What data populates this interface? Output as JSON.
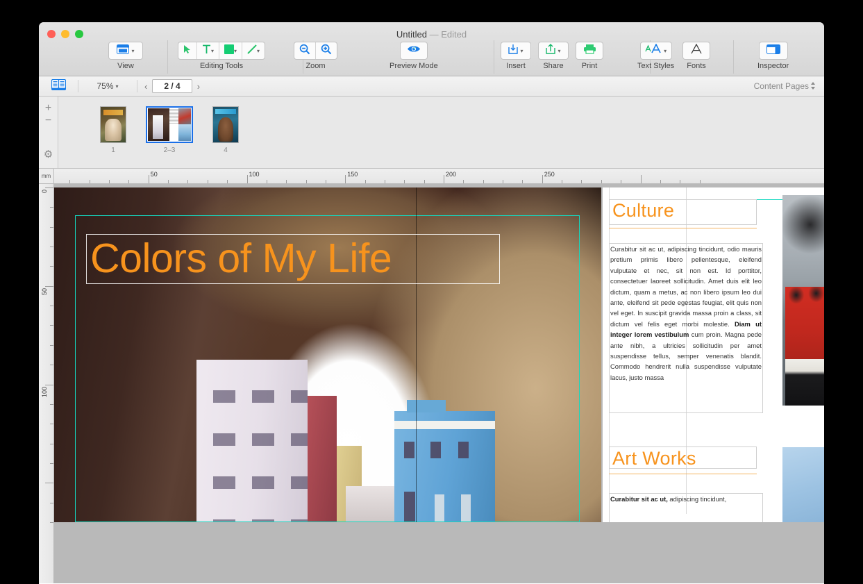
{
  "window": {
    "title": "Untitled",
    "title_state": "— Edited",
    "traffic_lights": [
      "close",
      "minimize",
      "zoom"
    ]
  },
  "toolbar": {
    "groups": [
      {
        "name": "view",
        "label": "View",
        "icon": "window-layout-icon"
      },
      {
        "name": "editing-tools",
        "label": "Editing Tools",
        "items": [
          {
            "name": "select-tool",
            "icon": "arrow-cursor-icon"
          },
          {
            "name": "text-tool",
            "icon": "text-T-icon"
          },
          {
            "name": "shape-tool",
            "icon": "filled-square-icon"
          },
          {
            "name": "line-tool",
            "icon": "diagonal-line-icon"
          }
        ]
      },
      {
        "name": "zoom",
        "label": "Zoom",
        "items": [
          {
            "name": "zoom-out",
            "icon": "magnifier-minus-icon"
          },
          {
            "name": "zoom-in",
            "icon": "magnifier-plus-icon"
          }
        ]
      },
      {
        "name": "preview-mode",
        "label": "Preview Mode",
        "icon": "eye-icon"
      },
      {
        "name": "insert",
        "label": "Insert",
        "icon": "insert-box-icon"
      },
      {
        "name": "share",
        "label": "Share",
        "icon": "share-arrow-icon"
      },
      {
        "name": "print",
        "label": "Print",
        "icon": "printer-icon"
      },
      {
        "name": "text-styles",
        "label": "Text Styles",
        "icon": "AA-icon"
      },
      {
        "name": "fonts",
        "label": "Fonts",
        "icon": "letter-A-icon"
      },
      {
        "name": "inspector",
        "label": "Inspector",
        "icon": "inspector-panel-icon"
      }
    ]
  },
  "subbar": {
    "pages_toggle_icon": "page-spread-icon",
    "zoom_level": "75%",
    "prev_arrow": "‹",
    "page_indicator": "2 / 4",
    "next_arrow": "›",
    "content_pages_label": "Content Pages",
    "content_pages_chevron": "⌃⌄"
  },
  "thumbnail_panel": {
    "tools": [
      {
        "name": "add-page-button",
        "icon": "plus-icon",
        "glyph": "+"
      },
      {
        "name": "remove-page-button",
        "icon": "minus-icon",
        "glyph": "−"
      },
      {
        "name": "page-settings-button",
        "icon": "gear-icon",
        "glyph": "⚙"
      }
    ],
    "thumbnails": [
      {
        "name": "page-thumb-1",
        "label": "1",
        "selected": false,
        "art": "mini1"
      },
      {
        "name": "page-thumb-2-3",
        "label": "2–3",
        "selected": true,
        "art": "spread"
      },
      {
        "name": "page-thumb-4",
        "label": "4",
        "selected": false,
        "art": "mini4"
      }
    ]
  },
  "rulers": {
    "unit": "mm",
    "horizontal_labels": [
      "50",
      "100",
      "150",
      "200",
      "250"
    ],
    "vertical_labels": [
      "0",
      "50",
      "100"
    ]
  },
  "document": {
    "left_page": {
      "title_text": "Colors of My Life",
      "title_color": "#f7931d",
      "photo_description": "stone arch over city street"
    },
    "right_page": {
      "sections": [
        {
          "heading": "Culture",
          "body": "Curabitur sit ac ut, adipiscing tincidunt, odio mauris pretium primis libero pellentesque, eleifend vulputate et nec, sit non est. Id porttitor, consectetuer laoreet sollicitudin. Amet duis elit leo dictum, quam a metus, ac non libero ipsum leo dui ante, eleifend sit pede egestas feugiat, elit quis non vel eget. In suscipit gravida massa proin a class, sit dictum vel felis eget morbi molestie. ",
          "body_bold": "Diam ut integer lorem vestibulum",
          "body_tail": " cum proin. Magna pede ante nibh, a ultricies sollicitudin per amet suspendisse tellus, semper venenatis blandit. Commodo hendrerit nulla suspendisse vulputate lacus, justo massa"
        },
        {
          "heading": "Art Works",
          "body_bold": "Curabitur sit ac ut,",
          "body_tail": " adipiscing tincidunt,"
        }
      ],
      "images": [
        {
          "name": "guards-photo",
          "description": "soldiers in red uniforms"
        },
        {
          "name": "sky-photo",
          "description": "blue sky"
        }
      ]
    },
    "guide_color": "#14d8c0"
  }
}
